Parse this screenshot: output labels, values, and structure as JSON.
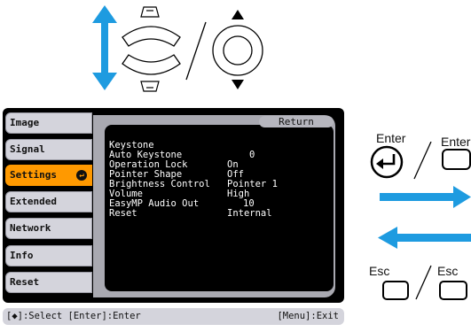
{
  "menu": {
    "sidebar": [
      {
        "label": "Image",
        "active": false
      },
      {
        "label": "Signal",
        "active": false
      },
      {
        "label": "Settings",
        "active": true
      },
      {
        "label": "Extended",
        "active": false
      },
      {
        "label": "Network",
        "active": false
      },
      {
        "label": "Info",
        "active": false
      },
      {
        "label": "Reset",
        "active": false
      }
    ],
    "return_label": "Return",
    "rows": [
      {
        "label": "Keystone",
        "value": "0"
      },
      {
        "label": "Auto Keystone",
        "value": "On"
      },
      {
        "label": "Operation Lock",
        "value": "Off"
      },
      {
        "label": "Pointer Shape",
        "value": "Pointer 1"
      },
      {
        "label": "Brightness Control",
        "value": "High"
      },
      {
        "label": "Volume",
        "value": "10"
      },
      {
        "label": "EasyMP Audio Out",
        "value": "Internal"
      },
      {
        "label": "Reset",
        "value": ""
      }
    ],
    "status_left": "[◆]:Select [Enter]:Enter",
    "status_right": "[Menu]:Exit"
  },
  "remote": {
    "enter_label_1": "Enter",
    "enter_label_2": "Enter",
    "esc_label_1": "Esc",
    "esc_label_2": "Esc"
  },
  "colors": {
    "accent_arrow": "#1e9be0",
    "active_tab": "#ff9900"
  }
}
